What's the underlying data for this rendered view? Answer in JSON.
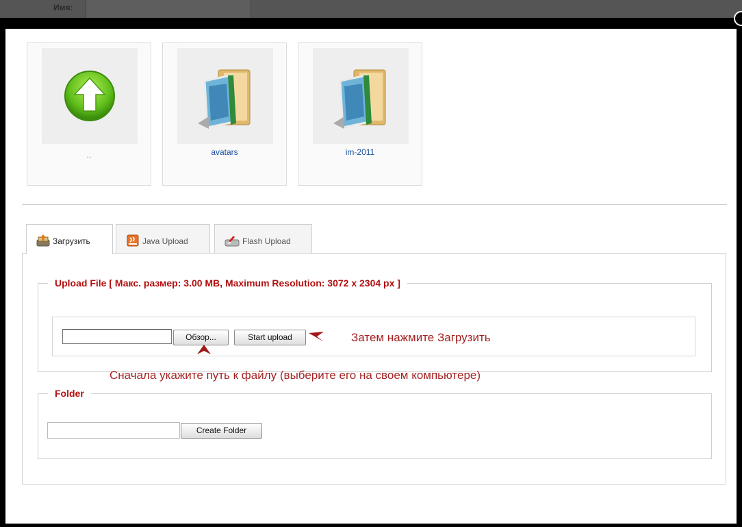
{
  "background": {
    "name_label": "Имя:"
  },
  "colors": {
    "legend_red": "#b30f0f",
    "hint_red": "#a52222",
    "link_blue": "#1a4fa0"
  },
  "folders": [
    {
      "label": "..",
      "icon": "up-arrow-icon"
    },
    {
      "label": "avatars",
      "icon": "folder-icon"
    },
    {
      "label": "im-2011",
      "icon": "folder-icon"
    }
  ],
  "tabs": [
    {
      "label": "Загрузить",
      "icon": "upload-icon",
      "active": true
    },
    {
      "label": "Java Upload",
      "icon": "java-icon",
      "active": false
    },
    {
      "label": "Flash Upload",
      "icon": "flash-icon",
      "active": false
    }
  ],
  "upload": {
    "legend": "Upload File [ Макс. размер: 3.00 MB, Maximum Resolution: 3072 x 2304 px ]",
    "file_value": "",
    "browse_label": "Обзор...",
    "start_label": "Start upload",
    "hint_start": "Затем нажмите Загрузить",
    "hint_path": "Сначала укажите путь к файлу (выберите его на своем компьютере)"
  },
  "folder_section": {
    "legend": "Folder",
    "input_value": "",
    "create_label": "Create Folder"
  }
}
